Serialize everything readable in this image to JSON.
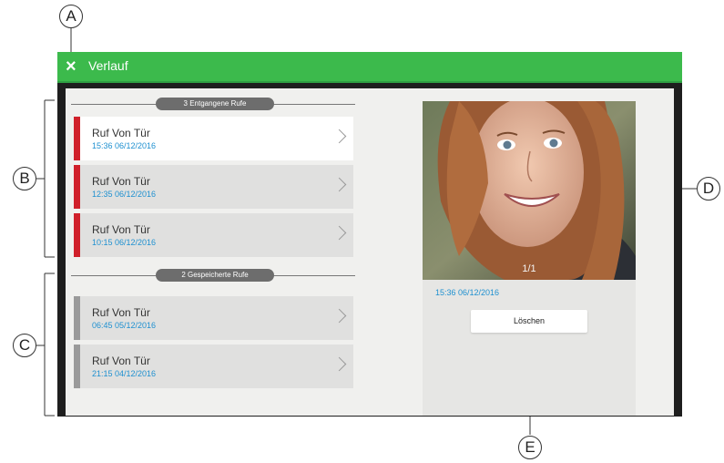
{
  "callouts": {
    "a": "A",
    "b": "B",
    "c": "C",
    "d": "D",
    "e": "E"
  },
  "titlebar": {
    "close_icon": "×",
    "title": "Verlauf",
    "color": "#3cba4c"
  },
  "missed": {
    "header": "3 Entgangene Rufe",
    "accent": "#d0202a",
    "items": [
      {
        "name": "Ruf Von Tür",
        "time": "15:36 06/12/2016"
      },
      {
        "name": "Ruf Von Tür",
        "time": "12:35 06/12/2016"
      },
      {
        "name": "Ruf Von Tür",
        "time": "10:15 06/12/2016"
      }
    ]
  },
  "saved": {
    "header": "2 Gespeicherte Rufe",
    "accent": "#9a9a9a",
    "items": [
      {
        "name": "Ruf Von Tür",
        "time": "06:45 05/12/2016"
      },
      {
        "name": "Ruf Von Tür",
        "time": "21:15 04/12/2016"
      }
    ]
  },
  "detail": {
    "counter": "1/1",
    "timestamp": "15:36 06/12/2016",
    "delete_label": "Löschen"
  }
}
